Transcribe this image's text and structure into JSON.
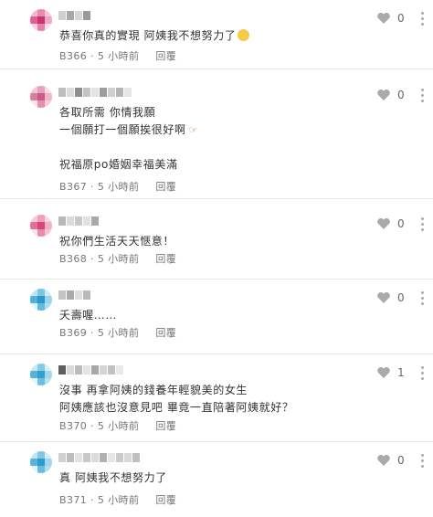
{
  "comments": [
    {
      "id": "B366",
      "lines": [
        "恭喜你真的實現 阿姨我不想努力了"
      ],
      "emoji": "laughing-emoji",
      "floor": "B366",
      "time": "5 小時前",
      "reply": "回覆",
      "likes": "0",
      "avatar_colors": [
        "#f4b9cf",
        "#e98bb0",
        "#f6c7d8",
        "#e25f93",
        "#c9336e",
        "#f0a7c3",
        "#f7d1df",
        "#e77fa9",
        "#fae0ea"
      ],
      "name_colors": [
        "#cfcfcf",
        "#a8a8a8",
        "#d6d6d6",
        "#9a9a9a"
      ]
    },
    {
      "id": "B367",
      "lines": [
        "各取所需 你情我願",
        "一個願打一個願挨很好啊",
        "",
        "祝福原po婚姻幸福美滿"
      ],
      "floor": "B367",
      "time": "5 小時前",
      "reply": "回覆",
      "likes": "0",
      "avatar_colors": [
        "#f3c4d6",
        "#e6a1bd",
        "#f8dbe6",
        "#d97ea3",
        "#c95b88",
        "#efb3ca",
        "#fae5ed",
        "#e48fb2",
        "#f5ccdb"
      ],
      "name_colors": [
        "#bdbdbd",
        "#dcdcdc",
        "#8e8e8e",
        "#c4c4c4",
        "#e3e3e3",
        "#9c9c9c",
        "#d0d0d0",
        "#b5b5b5",
        "#e6e6e6"
      ]
    },
    {
      "id": "B368",
      "lines": [
        "祝你們生活天天愜意！"
      ],
      "floor": "B368",
      "time": "5 小時前",
      "reply": "回覆",
      "likes": "0",
      "avatar_colors": [
        "#f7c8d7",
        "#ee9fbb",
        "#f9d7e2",
        "#e66e97",
        "#d4477a",
        "#f2b0c6",
        "#fbe3eb",
        "#eb8aac",
        "#f6c1d3"
      ],
      "name_colors": [
        "#b8b8b8",
        "#dadada",
        "#c9c9c9",
        "#e1e1e1",
        "#a9a9a9"
      ]
    },
    {
      "id": "B369",
      "lines": [
        "夭壽喔……"
      ],
      "floor": "B369",
      "time": "5 小時前",
      "reply": "回覆",
      "likes": "0",
      "avatar_colors": [
        "#bfe4f2",
        "#7cc6e4",
        "#d2ecf6",
        "#4fb0d8",
        "#2f97c5",
        "#9ad4ea",
        "#e0f2f9",
        "#64bbdf",
        "#b3def0"
      ],
      "name_colors": [
        "#c4c4c4",
        "#aaaaaa",
        "#dedede",
        "#b9b9b9"
      ]
    },
    {
      "id": "B370",
      "lines": [
        "沒事 再拿阿姨的錢養年輕貌美的女生",
        "阿姨應該也沒意見吧 畢竟一直陪著阿姨就好？"
      ],
      "floor": "B370",
      "time": "5 小時前",
      "reply": "回覆",
      "likes": "1",
      "avatar_colors": [
        "#c6e7f3",
        "#86cbe6",
        "#d9eff7",
        "#53b3da",
        "#3a9ecb",
        "#a3d8ec",
        "#e6f4fa",
        "#6dc0e1",
        "#badff0"
      ],
      "name_colors": [
        "#5f5f5f",
        "#dadada",
        "#bcbcbc",
        "#e4e4e4",
        "#a7a7a7",
        "#d4d4d4",
        "#c2c2c2",
        "#e9e9e9"
      ]
    },
    {
      "id": "B371",
      "lines": [
        "真 阿姨我不想努力了"
      ],
      "floor": "B371",
      "time": "5 小時前",
      "reply": "回覆",
      "likes": "0",
      "avatar_colors": [
        "#c2e5f2",
        "#80c8e5",
        "#d5edf6",
        "#56b4da",
        "#339bc8",
        "#a0d6eb",
        "#e3f3f9",
        "#69bde0",
        "#b6dcef"
      ],
      "name_colors": [
        "#d0d0d0",
        "#bdbdbd",
        "#e2e2e2",
        "#c8c8c8",
        "#dcdcdc",
        "#b0b0b0",
        "#e6e6e6",
        "#cacaca",
        "#d8d8d8",
        "#c0c0c0"
      ]
    }
  ],
  "icons": {
    "like": "heart-outline-icon",
    "more": "more-vertical-icon",
    "point": "pointing-hand-emoji"
  },
  "colors": {
    "text": "#333333",
    "meta": "#777777",
    "icon": "#aaaaaa",
    "divider": "#e8e8e8"
  }
}
